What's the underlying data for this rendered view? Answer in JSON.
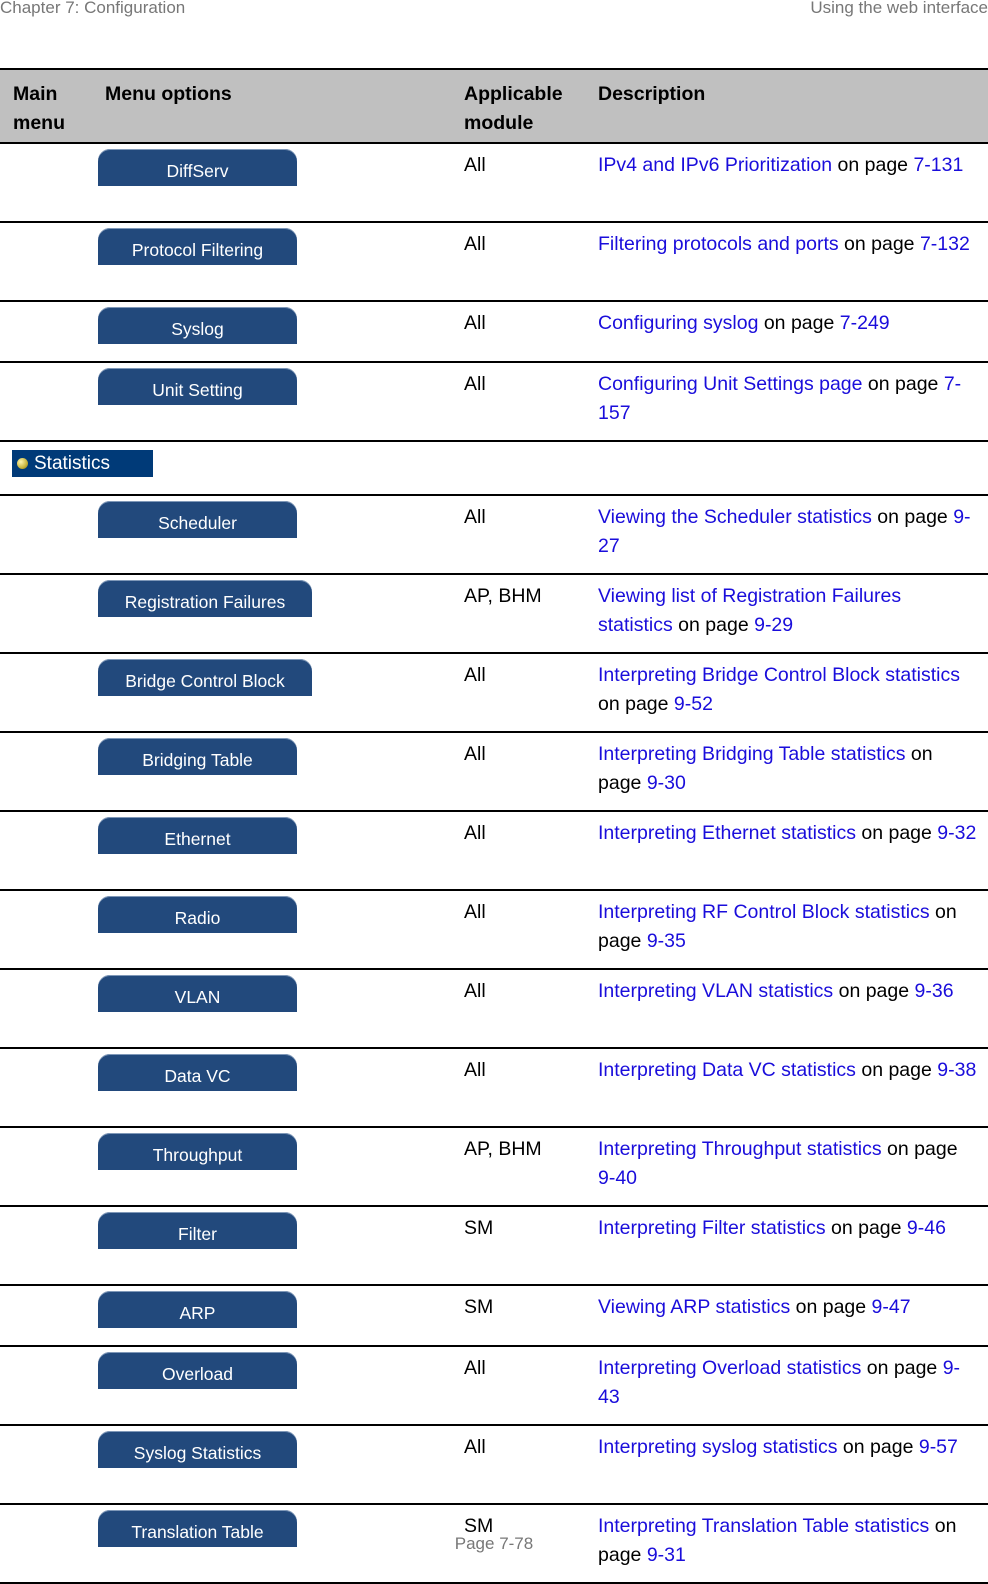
{
  "header": {
    "chapter": "Chapter 7:  Configuration",
    "section": "Using the web interface"
  },
  "table": {
    "columns": [
      "Main menu",
      "Menu options",
      "Applicable module",
      "Description"
    ],
    "rows_config": [
      {
        "button": "DiffServ",
        "module": "All",
        "link": "IPv4 and IPv6 Prioritization",
        "mid": " on page ",
        "page": "7-131"
      },
      {
        "button": "Protocol Filtering",
        "module": "All",
        "link": "Filtering protocols and ports",
        "mid": " on page ",
        "page": "7-132"
      },
      {
        "button": "Syslog",
        "module": "All",
        "link": "Configuring syslog",
        "mid": " on page ",
        "page": "7-249"
      },
      {
        "button": "Unit Setting",
        "module": "All",
        "link": "Configuring Unit Settings page",
        "mid": " on page ",
        "page": "7-157"
      }
    ],
    "section": {
      "label": "Statistics",
      "icon": "yellow-bullet-icon"
    },
    "rows_statistics": [
      {
        "button": "Scheduler",
        "module": "All",
        "link": "Viewing the Scheduler statistics",
        "mid": " on page ",
        "page": "9-27"
      },
      {
        "button": "Registration Failures",
        "module": "AP, BHM",
        "link": "Viewing list of Registration Failures statistics",
        "mid": " on page ",
        "page": "9-29"
      },
      {
        "button": "Bridge Control Block",
        "module": "All",
        "link": "Interpreting Bridge Control Block statistics",
        "mid": " on page ",
        "page": "9-52"
      },
      {
        "button": "Bridging Table",
        "module": "All",
        "link": "Interpreting Bridging Table statistics",
        "mid": " on page ",
        "page": "9-30"
      },
      {
        "button": "Ethernet",
        "module": "All",
        "link": "Interpreting Ethernet statistics",
        "mid": " on page ",
        "page": "9-32"
      },
      {
        "button": "Radio",
        "module": "All",
        "link": "Interpreting RF Control Block statistics",
        "mid": " on page ",
        "page": "9-35"
      },
      {
        "button": "VLAN",
        "module": "All",
        "link": "Interpreting VLAN statistics",
        "mid": " on page ",
        "page": "9-36"
      },
      {
        "button": "Data VC",
        "module": "All",
        "link": "Interpreting Data VC statistics",
        "mid": " on page ",
        "page": "9-38"
      },
      {
        "button": "Throughput",
        "module": "AP, BHM",
        "link": "Interpreting Throughput statistics",
        "mid": " on page ",
        "page": "9-40"
      },
      {
        "button": "Filter",
        "module": "SM",
        "link": "Interpreting Filter statistics",
        "mid": " on page ",
        "page": "9-46"
      },
      {
        "button": "ARP",
        "module": "SM",
        "link": "Viewing ARP statistics",
        "mid": " on page ",
        "page": "9-47"
      },
      {
        "button": "Overload",
        "module": "All",
        "link": "Interpreting Overload statistics",
        "mid": " on page ",
        "page": "9-43"
      },
      {
        "button": "Syslog Statistics",
        "module": "All",
        "link": "Interpreting syslog statistics",
        "mid": " on page ",
        "page": "9-57"
      },
      {
        "button": "Translation Table",
        "module": "SM",
        "link": "Interpreting Translation Table statistics",
        "mid": " on page ",
        "page": "9-31"
      }
    ]
  },
  "colors": {
    "button_bg": "#22497c",
    "section_bg": "#003a78",
    "header_bg": "#c0c0c0",
    "link": "#1a0ddb"
  },
  "footer": {
    "page": "Page 7-78"
  }
}
